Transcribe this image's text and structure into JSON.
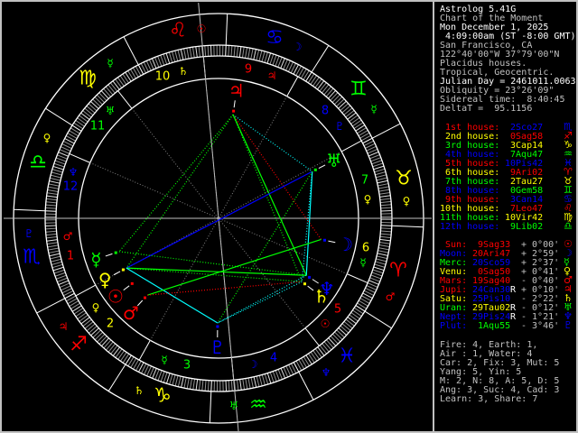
{
  "header": {
    "lines": [
      {
        "text": "Astrolog 5.41G",
        "color": "#ffffff"
      },
      {
        "text": "Chart of the Moment",
        "color": "#c0c0c0"
      },
      {
        "text": "Mon December 1, 2025",
        "color": "#ffffff"
      },
      {
        "text": " 4:09:00am (ST -8:00 GMT)",
        "color": "#ffffff"
      },
      {
        "text": "San Francisco, CA",
        "color": "#c0c0c0"
      },
      {
        "text": "122°40'00\"W 37°79'00\"N",
        "color": "#c0c0c0"
      },
      {
        "text": "Placidus houses.",
        "color": "#c0c0c0"
      },
      {
        "text": "Tropical, Geocentric.",
        "color": "#c0c0c0"
      },
      {
        "text": "Julian Day = 2461011.0063",
        "color": "#ffffff"
      },
      {
        "text": "Obliquity = 23°26'09\"",
        "color": "#c0c0c0"
      },
      {
        "text": "Sidereal time:  8:40:45",
        "color": "#c0c0c0"
      },
      {
        "text": "DeltaT =  95.1156",
        "color": "#c0c0c0"
      }
    ]
  },
  "houses": [
    {
      "label": " 1st house:",
      "position": " 2Sco27",
      "glyph": "♏",
      "label_color": "#ff0000",
      "value_color": "#0000ff",
      "longitude": 212.45
    },
    {
      "label": " 2nd house:",
      "position": " 0Sag58",
      "glyph": "♐",
      "label_color": "#ffff00",
      "value_color": "#ff0000",
      "longitude": 240.97
    },
    {
      "label": " 3rd house:",
      "position": " 3Cap14",
      "glyph": "♑",
      "label_color": "#00ff00",
      "value_color": "#ffff00",
      "longitude": 273.23
    },
    {
      "label": " 4th house:",
      "position": " 7Aqu47",
      "glyph": "♒",
      "label_color": "#0000ff",
      "value_color": "#00ff00",
      "longitude": 307.78
    },
    {
      "label": " 5th house:",
      "position": "10Pis42",
      "glyph": "♓",
      "label_color": "#ff0000",
      "value_color": "#0000ff",
      "longitude": 340.7
    },
    {
      "label": " 6th house:",
      "position": " 9Ari02",
      "glyph": "♈",
      "label_color": "#ffff00",
      "value_color": "#ff0000",
      "longitude": 9.03
    },
    {
      "label": " 7th house:",
      "position": " 2Tau27",
      "glyph": "♉",
      "label_color": "#00ff00",
      "value_color": "#ffff00",
      "longitude": 32.45
    },
    {
      "label": " 8th house:",
      "position": " 0Gem58",
      "glyph": "♊",
      "label_color": "#0000ff",
      "value_color": "#00ff00",
      "longitude": 60.97
    },
    {
      "label": " 9th house:",
      "position": " 3Can14",
      "glyph": "♋",
      "label_color": "#ff0000",
      "value_color": "#0000ff",
      "longitude": 93.23
    },
    {
      "label": "10th house:",
      "position": " 7Leo47",
      "glyph": "♌",
      "label_color": "#ffff00",
      "value_color": "#ff0000",
      "longitude": 127.78
    },
    {
      "label": "11th house:",
      "position": "10Vir42",
      "glyph": "♍",
      "label_color": "#00ff00",
      "value_color": "#ffff00",
      "longitude": 160.7
    },
    {
      "label": "12th house:",
      "position": " 9Lib02",
      "glyph": "♎",
      "label_color": "#0000ff",
      "value_color": "#00ff00",
      "longitude": 189.03
    }
  ],
  "planets": [
    {
      "id": "Sun",
      "name": " Sun:",
      "position": " 9Sag33",
      "retro": "",
      "aspect": "+ 0°00'",
      "glyph": "☉",
      "color": "#ff0000",
      "value_color": "#ff0000",
      "longitude": 249.55
    },
    {
      "id": "Moon",
      "name": "Moon:",
      "position": "20Ari47",
      "retro": "",
      "aspect": "+ 2°59'",
      "glyph": "☽",
      "color": "#0000ff",
      "value_color": "#ff0000",
      "longitude": 20.78
    },
    {
      "id": "Merc",
      "name": "Merc:",
      "position": "20Sco59",
      "retro": "",
      "aspect": "+ 2°37'",
      "glyph": "☿",
      "color": "#00ff00",
      "value_color": "#0000ff",
      "longitude": 230.98
    },
    {
      "id": "Venu",
      "name": "Venu:",
      "position": " 0Sag50",
      "retro": "",
      "aspect": "+ 0°41'",
      "glyph": "♀",
      "color": "#ffff00",
      "value_color": "#ff0000",
      "longitude": 240.83
    },
    {
      "id": "Mars",
      "name": "Mars:",
      "position": "19Sag40",
      "retro": "",
      "aspect": "- 0°40'",
      "glyph": "♂",
      "color": "#ff0000",
      "value_color": "#ff0000",
      "longitude": 259.67
    },
    {
      "id": "Jupi",
      "name": "Jupi:",
      "position": "24Can30",
      "retro": "R",
      "aspect": "+ 0°10'",
      "glyph": "♃",
      "color": "#ff0000",
      "value_color": "#0000ff",
      "longitude": 114.5
    },
    {
      "id": "Satu",
      "name": "Satu:",
      "position": "25Pis10",
      "retro": "",
      "aspect": "- 2°22'",
      "glyph": "♄",
      "color": "#ffff00",
      "value_color": "#0000ff",
      "longitude": 355.17
    },
    {
      "id": "Uran",
      "name": "Uran:",
      "position": "29Tau02",
      "retro": "R",
      "aspect": "- 0°12'",
      "glyph": "♅",
      "color": "#00ff00",
      "value_color": "#ffff00",
      "longitude": 59.03
    },
    {
      "id": "Nept",
      "name": "Nept:",
      "position": "29Pis24",
      "retro": "R",
      "aspect": "- 1°21'",
      "glyph": "♆",
      "color": "#0000ff",
      "value_color": "#0000ff",
      "longitude": 359.4
    },
    {
      "id": "Plut",
      "name": "Plut:",
      "position": " 1Aqu55",
      "retro": "",
      "aspect": "- 3°46'",
      "glyph": "♇",
      "color": "#0000ff",
      "value_color": "#00ff00",
      "longitude": 301.92
    }
  ],
  "summary": [
    "Fire: 4, Earth: 1,",
    "Air : 1, Water: 4",
    "Car: 2, Fix: 3, Mut: 5",
    "Yang: 5, Yin: 5",
    "M: 2, N: 8, A: 5, D: 5",
    "Ang: 3, Suc: 4, Cad: 3",
    "Learn: 3, Share: 7"
  ],
  "wheel": {
    "ascendant_longitude": 212.45,
    "midheaven_longitude": 127.78,
    "signs": [
      {
        "glyph": "♈",
        "color": "#ff0000",
        "ruler": "♂",
        "ruler_color": "#ff0000"
      },
      {
        "glyph": "♉",
        "color": "#ffff00",
        "ruler": "♀",
        "ruler_color": "#ffff00"
      },
      {
        "glyph": "♊",
        "color": "#00ff00",
        "ruler": "☿",
        "ruler_color": "#00ff00"
      },
      {
        "glyph": "♋",
        "color": "#0000ff",
        "ruler": "☽",
        "ruler_color": "#0000ff"
      },
      {
        "glyph": "♌",
        "color": "#ff0000",
        "ruler": "☉",
        "ruler_color": "#ff0000"
      },
      {
        "glyph": "♍",
        "color": "#ffff00",
        "ruler": "☿",
        "ruler_color": "#00ff00"
      },
      {
        "glyph": "♎",
        "color": "#00ff00",
        "ruler": "♀",
        "ruler_color": "#ffff00"
      },
      {
        "glyph": "♏",
        "color": "#0000ff",
        "ruler": "♇",
        "ruler_color": "#0000ff"
      },
      {
        "glyph": "♐",
        "color": "#ff0000",
        "ruler": "♃",
        "ruler_color": "#ff0000"
      },
      {
        "glyph": "♑",
        "color": "#ffff00",
        "ruler": "♄",
        "ruler_color": "#ffff00"
      },
      {
        "glyph": "♒",
        "color": "#00ff00",
        "ruler": "♅",
        "ruler_color": "#00ff00"
      },
      {
        "glyph": "♓",
        "color": "#0000ff",
        "ruler": "♆",
        "ruler_color": "#0000ff"
      }
    ],
    "house_ring": [
      {
        "number": "1",
        "color": "#ff0000",
        "ruler": "♂",
        "ruler_color": "#ff0000"
      },
      {
        "number": "2",
        "color": "#ffff00",
        "ruler": "♀",
        "ruler_color": "#ffff00"
      },
      {
        "number": "3",
        "color": "#00ff00",
        "ruler": "☿",
        "ruler_color": "#00ff00"
      },
      {
        "number": "4",
        "color": "#0000ff",
        "ruler": "☽",
        "ruler_color": "#0000ff"
      },
      {
        "number": "5",
        "color": "#ff0000",
        "ruler": "☉",
        "ruler_color": "#ff0000"
      },
      {
        "number": "6",
        "color": "#ffff00",
        "ruler": "☿",
        "ruler_color": "#00ff00"
      },
      {
        "number": "7",
        "color": "#00ff00",
        "ruler": "♀",
        "ruler_color": "#ffff00"
      },
      {
        "number": "8",
        "color": "#0000ff",
        "ruler": "♇",
        "ruler_color": "#0000ff"
      },
      {
        "number": "9",
        "color": "#ff0000",
        "ruler": "♃",
        "ruler_color": "#ff0000"
      },
      {
        "number": "10",
        "color": "#ffff00",
        "ruler": "♄",
        "ruler_color": "#ffff00"
      },
      {
        "number": "11",
        "color": "#00ff00",
        "ruler": "♅",
        "ruler_color": "#00ff00"
      },
      {
        "number": "12",
        "color": "#0000ff",
        "ruler": "♆",
        "ruler_color": "#0000ff"
      }
    ],
    "aspects": [
      {
        "from": "Jupi",
        "to": "Uran",
        "color": "#00ffff",
        "style": "dotted"
      },
      {
        "from": "Jupi",
        "to": "Moon",
        "color": "#ff0000",
        "style": "dotted"
      },
      {
        "from": "Jupi",
        "to": "Nept",
        "color": "#00ff00",
        "style": "solid"
      },
      {
        "from": "Jupi",
        "to": "Satu",
        "color": "#00ff00",
        "style": "dotted"
      },
      {
        "from": "Jupi",
        "to": "Merc",
        "color": "#00ff00",
        "style": "dotted"
      },
      {
        "from": "Jupi",
        "to": "Venu",
        "color": "#00ff00",
        "style": "dotted"
      },
      {
        "from": "Uran",
        "to": "Venu",
        "color": "#0000ff",
        "style": "solid"
      },
      {
        "from": "Uran",
        "to": "Nept",
        "color": "#00ffff",
        "style": "solid"
      },
      {
        "from": "Uran",
        "to": "Satu",
        "color": "#00ffff",
        "style": "dotted"
      },
      {
        "from": "Uran",
        "to": "Plut",
        "color": "#00ff00",
        "style": "dotted"
      },
      {
        "from": "Venu",
        "to": "Nept",
        "color": "#00ff00",
        "style": "solid"
      },
      {
        "from": "Venu",
        "to": "Satu",
        "color": "#00ff00",
        "style": "dotted"
      },
      {
        "from": "Venu",
        "to": "Plut",
        "color": "#00ffff",
        "style": "solid"
      },
      {
        "from": "Mars",
        "to": "Moon",
        "color": "#00ff00",
        "style": "solid"
      },
      {
        "from": "Mars",
        "to": "Satu",
        "color": "#ff0000",
        "style": "dotted"
      },
      {
        "from": "Merc",
        "to": "Nept",
        "color": "#00ff00",
        "style": "dotted"
      },
      {
        "from": "Nept",
        "to": "Plut",
        "color": "#00ffff",
        "style": "dotted"
      },
      {
        "from": "Satu",
        "to": "Plut",
        "color": "#00ffff",
        "style": "dotted"
      }
    ]
  }
}
